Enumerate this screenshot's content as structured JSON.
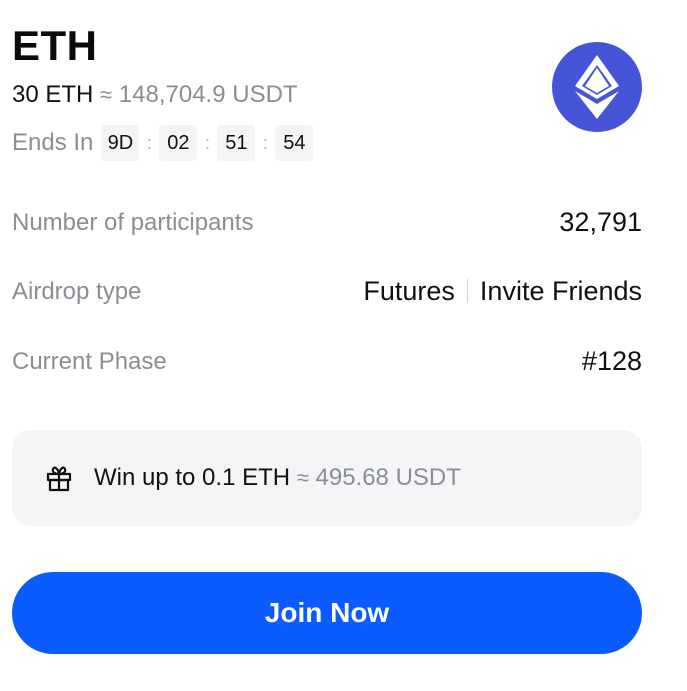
{
  "header": {
    "title": "ETH",
    "amount": "30 ETH",
    "approx_symbol": "≈",
    "usdt_value": "148,704.9 USDT"
  },
  "countdown": {
    "label": "Ends In",
    "days": "9D",
    "hours": "02",
    "minutes": "51",
    "seconds": "54",
    "separator": ":"
  },
  "logo": {
    "icon": "ethereum-logo-icon",
    "color": "#4654d8"
  },
  "details": [
    {
      "label": "Number of participants",
      "value": "32,791"
    },
    {
      "label": "Airdrop type",
      "value_a": "Futures",
      "value_b": "Invite Friends"
    },
    {
      "label": "Current Phase",
      "value": "#128"
    }
  ],
  "reward": {
    "icon": "gift-icon",
    "text": "Win up to 0.1 ETH",
    "approx_symbol": "≈",
    "usdt_value": "495.68 USDT"
  },
  "cta": {
    "label": "Join Now",
    "color": "#0a5cff"
  }
}
